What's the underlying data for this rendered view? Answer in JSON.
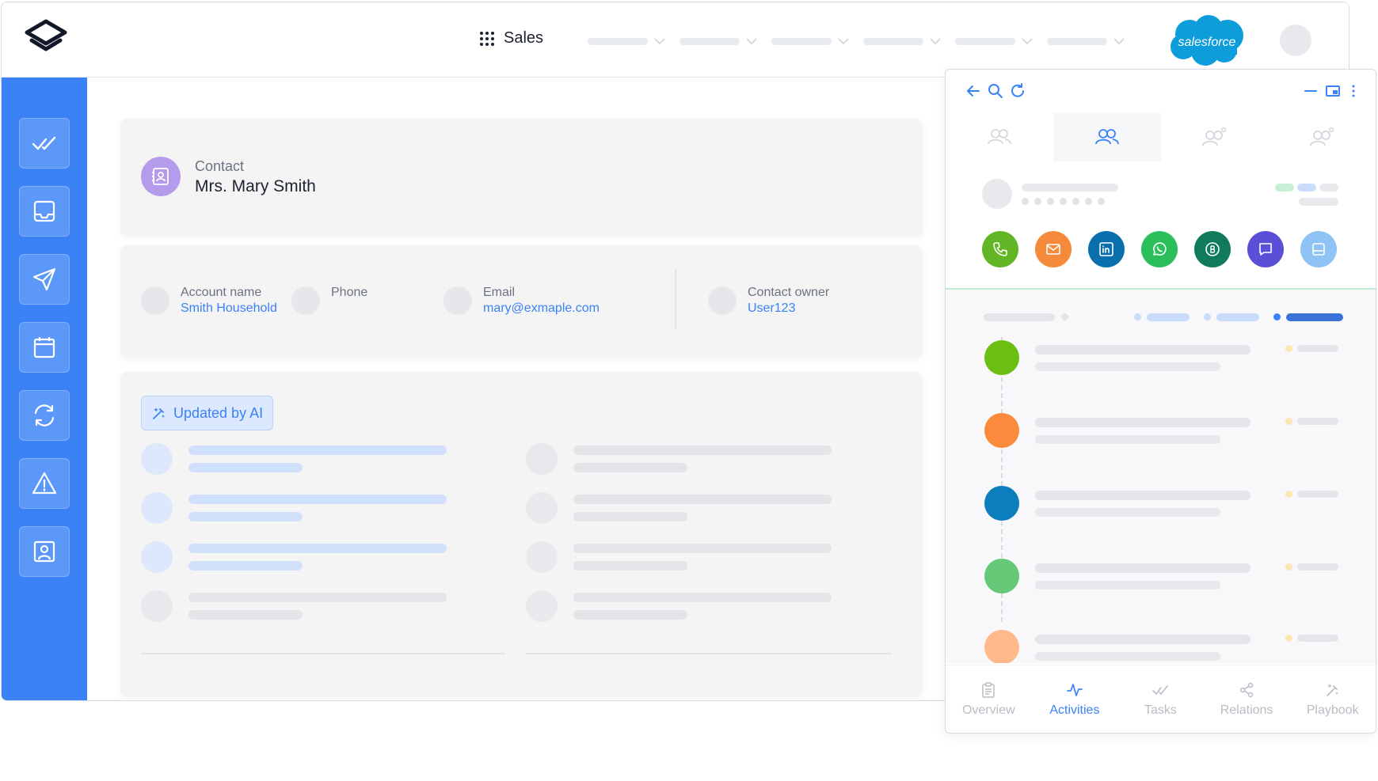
{
  "topbar": {
    "app_name": "Sales",
    "nav_count": 6,
    "brand_logo_text": "salesforce"
  },
  "sidebar": {
    "items": [
      {
        "icon": "double-check-icon"
      },
      {
        "icon": "inbox-icon"
      },
      {
        "icon": "send-icon"
      },
      {
        "icon": "calendar-icon"
      },
      {
        "icon": "sync-icon"
      },
      {
        "icon": "warning-icon"
      },
      {
        "icon": "contact-card-icon"
      }
    ]
  },
  "contact": {
    "type_label": "Contact",
    "name": "Mrs. Mary Smith"
  },
  "fields": {
    "account_label": "Account name",
    "account_value": "Smith Household",
    "phone_label": "Phone",
    "phone_value": "",
    "email_label": "Email",
    "email_value": "mary@exmaple.com",
    "owner_label": "Contact owner",
    "owner_value": "User123"
  },
  "ai_badge": {
    "label": "Updated by AI"
  },
  "panel": {
    "actions": [
      {
        "name": "phone",
        "color": "#62b524"
      },
      {
        "name": "email",
        "color": "#f58b3a"
      },
      {
        "name": "linkedin",
        "color": "#0a6fad"
      },
      {
        "name": "whatsapp",
        "color": "#2bbf5c"
      },
      {
        "name": "beeper",
        "color": "#0f7b5c"
      },
      {
        "name": "chat",
        "color": "#5b4fd8"
      },
      {
        "name": "window",
        "color": "#8fc3f5"
      }
    ],
    "timeline_colors": [
      "#6bbf13",
      "#fc8a3d",
      "#0b7ebd",
      "#66c977",
      "#ffb98b"
    ],
    "bottom_nav": [
      {
        "label": "Overview",
        "icon": "clipboard-icon",
        "active": false
      },
      {
        "label": "Activities",
        "icon": "activity-icon",
        "active": true
      },
      {
        "label": "Tasks",
        "icon": "double-check-icon",
        "active": false
      },
      {
        "label": "Relations",
        "icon": "share-icon",
        "active": false
      },
      {
        "label": "Playbook",
        "icon": "magic-wand-icon",
        "active": false
      }
    ]
  },
  "colors": {
    "accent": "#3b82f7",
    "sidebar": "#3b82f7",
    "contact_icon": "#b59bec"
  }
}
